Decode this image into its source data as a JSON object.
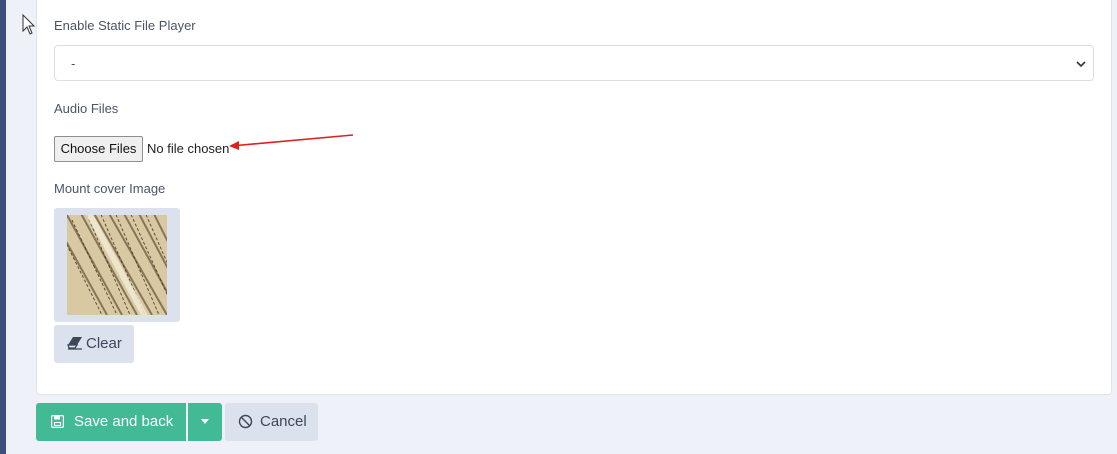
{
  "form": {
    "static_player": {
      "label": "Enable Static File Player",
      "selected_value": "-"
    },
    "audio_files": {
      "label": "Audio Files",
      "button_label": "Choose Files",
      "status_text": "No file chosen"
    },
    "cover_image": {
      "label": "Mount cover Image",
      "clear_label": "Clear"
    }
  },
  "actions": {
    "save_label": "Save and back",
    "cancel_label": "Cancel"
  },
  "icons": {
    "cursor": "mouse-pointer-icon",
    "chevron": "chevron-down-icon",
    "arrow": "red-annotation-arrow",
    "eraser": "eraser-icon",
    "save": "floppy-disk-icon",
    "caret": "caret-down-icon",
    "cancel": "ban-icon"
  },
  "colors": {
    "primary_green": "#42ba96",
    "secondary_bg": "#dbe2ee",
    "page_bg": "#eef1f7",
    "sidebar": "#3d4f7c",
    "annotation_arrow": "#e02020"
  }
}
